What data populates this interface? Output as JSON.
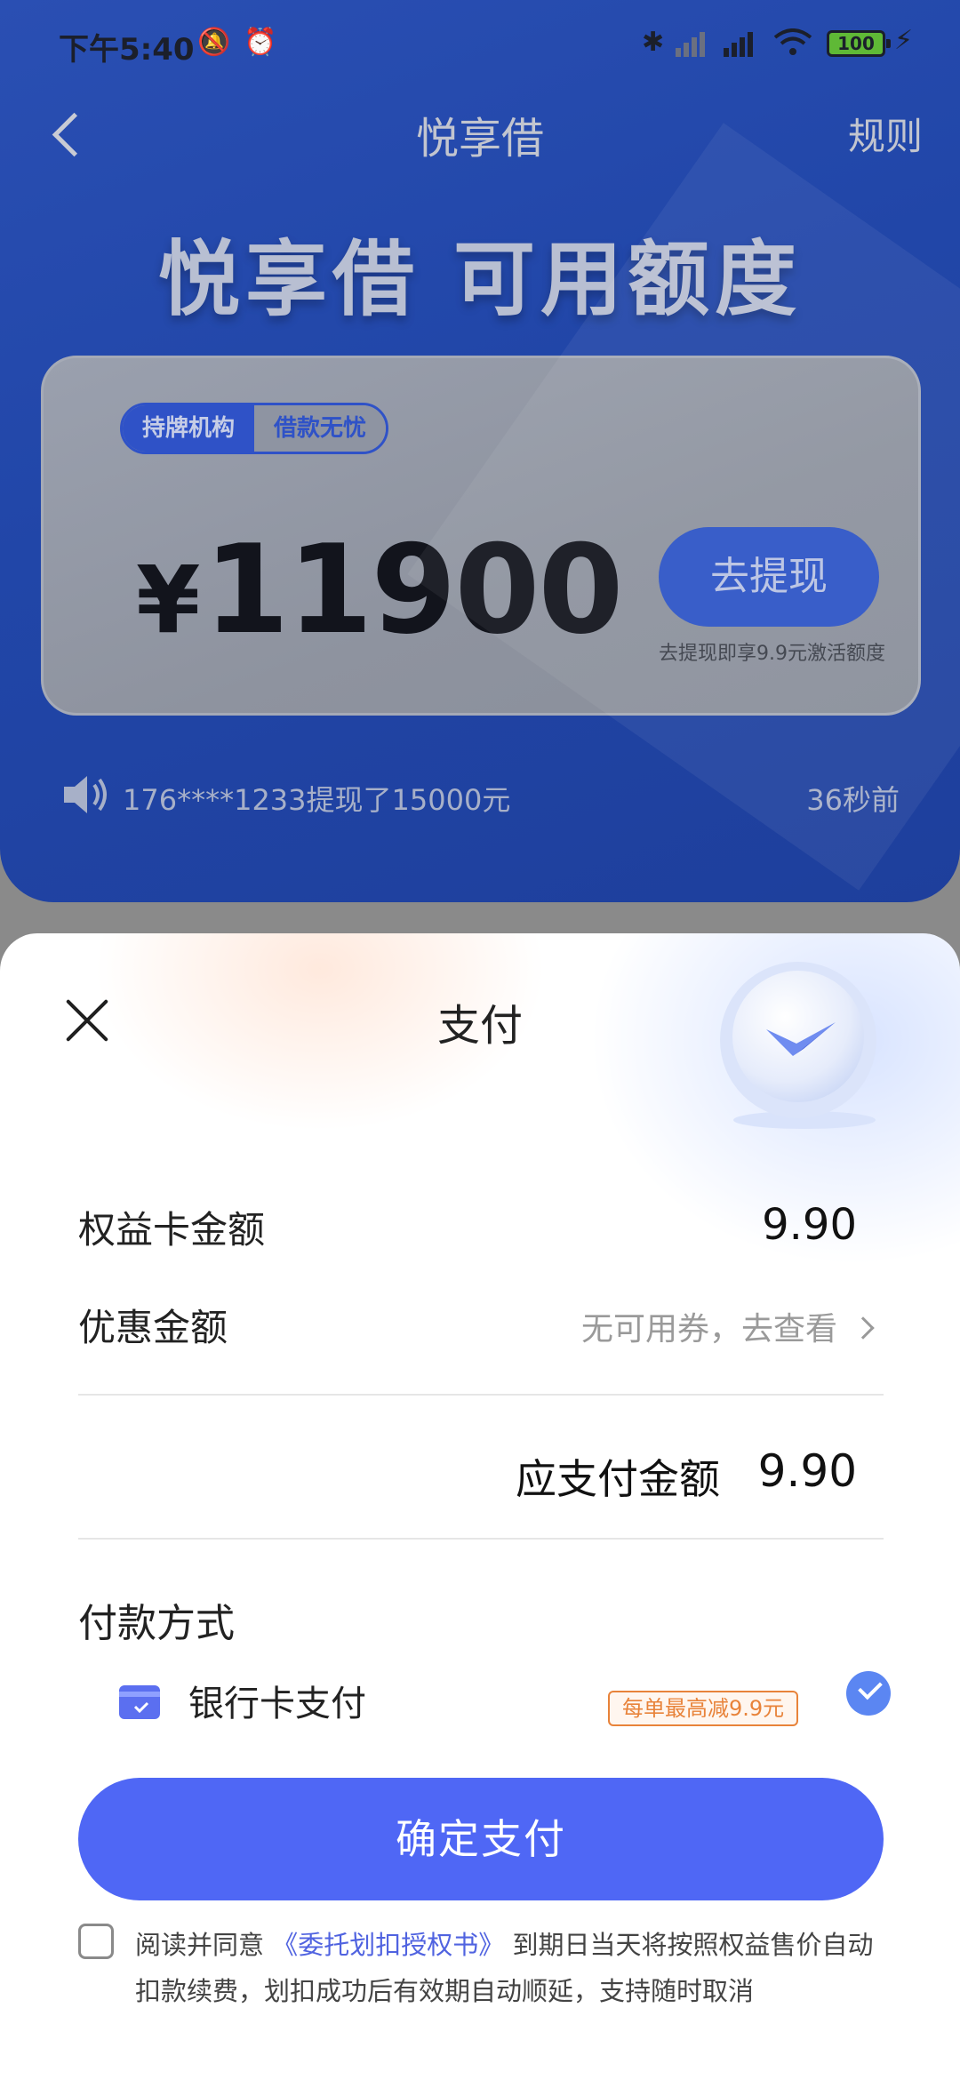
{
  "status_bar": {
    "time": "下午5:40",
    "battery": "100"
  },
  "nav": {
    "title": "悦享借",
    "rules": "规则"
  },
  "hero": {
    "heading": "悦享借 可用额度",
    "tag_licensed": "持牌机构",
    "tag_worry_free": "借款无忧",
    "currency": "¥",
    "amount": "11900",
    "withdraw_button": "去提现",
    "withdraw_hint": "去提现即享9.9元激活额度",
    "ticker_text": "176****1233提现了15000元",
    "ticker_time": "36秒前"
  },
  "sheet": {
    "title": "支付",
    "card_amount_label": "权益卡金额",
    "card_amount_value": "9.90",
    "discount_label": "优惠金额",
    "discount_value": "无可用券，去查看",
    "payable_label": "应支付金额",
    "payable_value": "9.90",
    "method_title": "付款方式",
    "method_bank_card": "银行卡支付",
    "promo_badge": "每单最高减9.9元",
    "confirm_button": "确定支付",
    "agreement_prefix": "阅读并同意",
    "agreement_link": "《委托划扣授权书》",
    "agreement_suffix": " 到期日当天将按照权益售价自动扣款续费，划扣成功后有效期自动顺延，支持随时取消"
  },
  "colors": {
    "accent_blue": "#4f67f5",
    "promo_orange": "#e8833a",
    "check_blue": "#5b86f2"
  }
}
